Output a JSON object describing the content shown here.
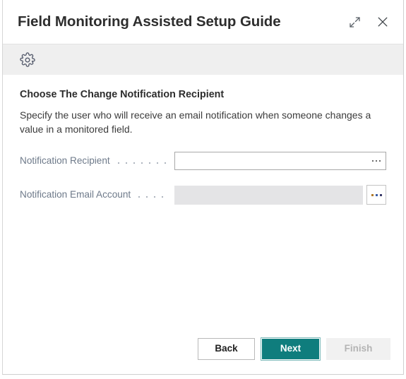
{
  "window": {
    "title": "Field Monitoring Assisted Setup Guide",
    "expand_icon": "expand-diagonal-icon",
    "close_icon": "close-icon",
    "accent_color": "#0f7d7d"
  },
  "toolbar": {
    "settings_icon": "gear-icon"
  },
  "main": {
    "heading": "Choose The Change Notification Recipient",
    "description": "Specify the user who will receive an email notification when someone changes a value in a monitored field.",
    "fields": [
      {
        "label": "Notification Recipient",
        "value": "",
        "placeholder": "",
        "enabled": true,
        "lookup_icon": "ellipsis-icon"
      },
      {
        "label": "Notification Email Account",
        "value": "",
        "placeholder": "",
        "enabled": false,
        "lookup_icon": "ellipsis-icon"
      }
    ]
  },
  "footer": {
    "back_label": "Back",
    "next_label": "Next",
    "finish_label": "Finish",
    "finish_disabled": true
  }
}
